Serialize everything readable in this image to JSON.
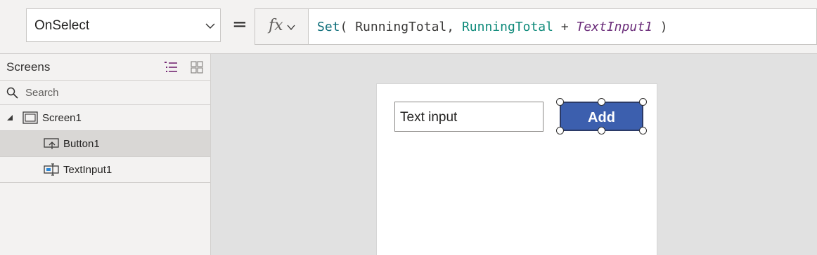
{
  "formula_bar": {
    "property": "OnSelect",
    "equals": "=",
    "fx_label": "fx",
    "formula": {
      "fn": "Set",
      "open": "( ",
      "arg1": "RunningTotal",
      "comma": ", ",
      "arg2": "RunningTotal",
      "plus": " + ",
      "arg3": "TextInput1",
      "close": " )"
    }
  },
  "tree_panel": {
    "title": "Screens",
    "search_placeholder": "Search",
    "nodes": [
      {
        "label": "Screen1",
        "icon": "screen-icon",
        "expanded": true
      },
      {
        "label": "Button1",
        "icon": "button-control-icon",
        "selected": true
      },
      {
        "label": "TextInput1",
        "icon": "text-input-control-icon"
      }
    ]
  },
  "canvas": {
    "text_input_value": "Text input",
    "button_label": "Add"
  },
  "colors": {
    "button_fill": "#3c5fae",
    "tree_view_accent": "#742774",
    "selected_row": "#d9d7d5",
    "canvas_bg": "#e1e1e1"
  }
}
